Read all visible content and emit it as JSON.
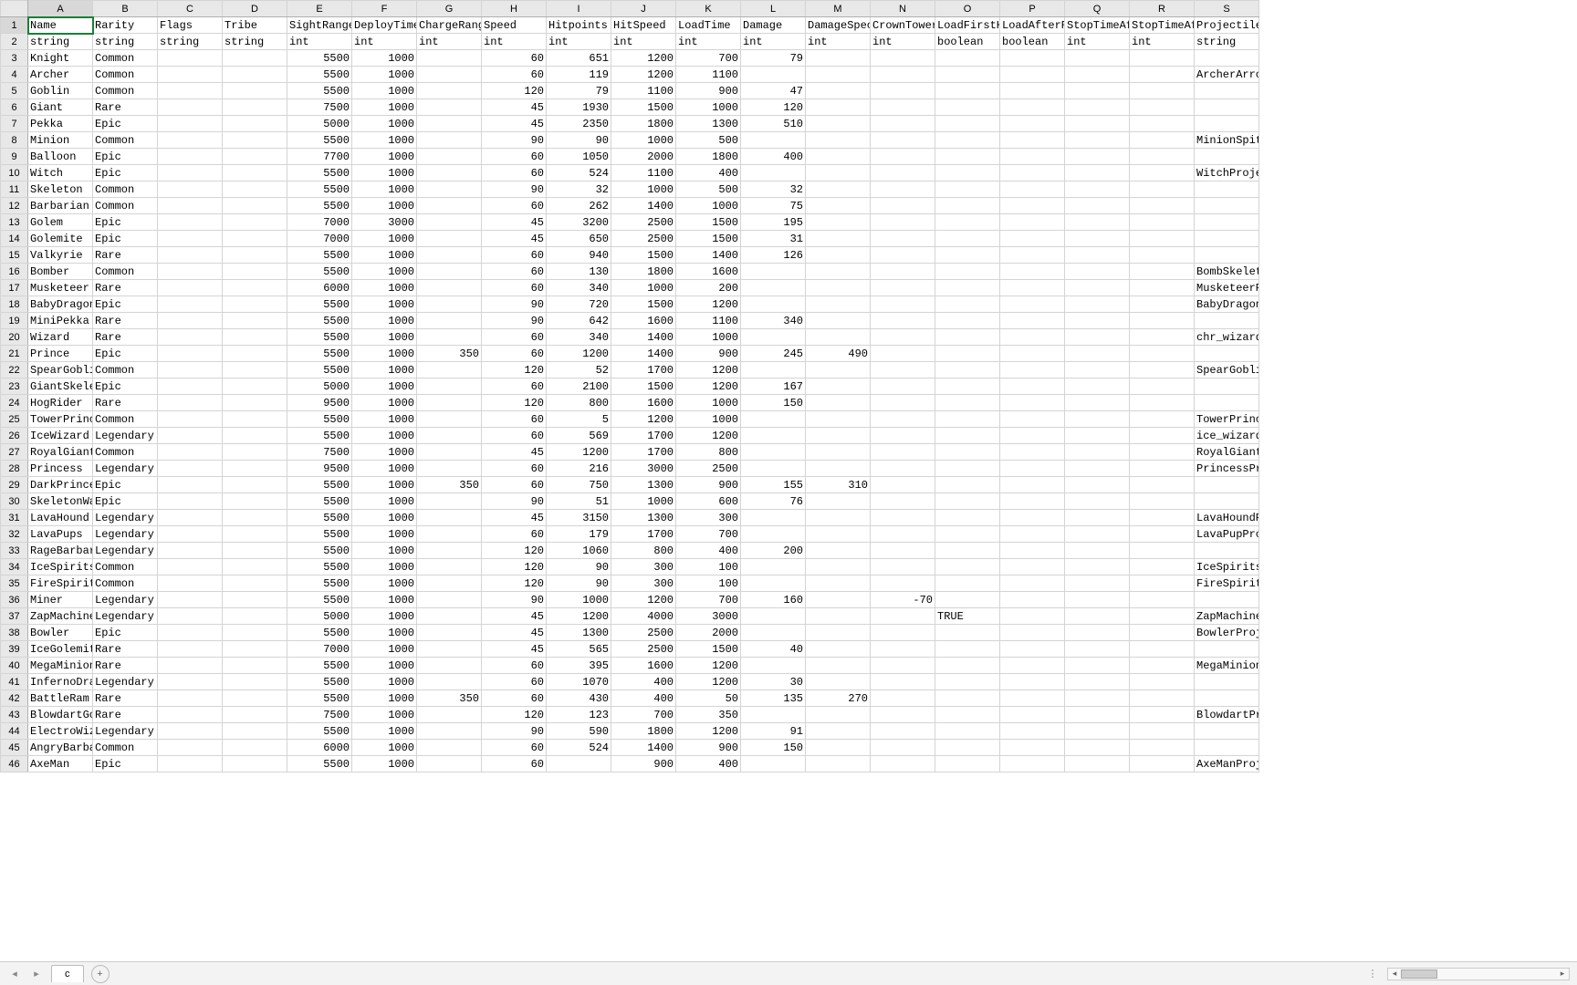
{
  "columns": [
    "A",
    "B",
    "C",
    "D",
    "E",
    "F",
    "G",
    "H",
    "I",
    "J",
    "K",
    "L",
    "M",
    "N",
    "O",
    "P",
    "Q",
    "R",
    "S"
  ],
  "rows": [
    {
      "n": 1,
      "cells": [
        "Name",
        "Rarity",
        "Flags",
        "Tribe",
        "SightRange",
        "DeployTime",
        "ChargeRange",
        "Speed",
        "Hitpoints",
        "HitSpeed",
        "LoadTime",
        "Damage",
        "DamageSpecial",
        "CrownTowerDamage",
        "LoadFirstHit",
        "LoadAfterRetarget",
        "StopTimeAfterAttack",
        "StopTimeAfterSpecialAttack",
        "Projectile"
      ]
    },
    {
      "n": 2,
      "cells": [
        "string",
        "string",
        "string",
        "string",
        "int",
        "int",
        "int",
        "int",
        "int",
        "int",
        "int",
        "int",
        "int",
        "int",
        "boolean",
        "boolean",
        "int",
        "int",
        "string"
      ]
    },
    {
      "n": 3,
      "cells": [
        "Knight",
        "Common",
        "",
        "",
        "5500",
        "1000",
        "",
        "60",
        "651",
        "1200",
        "700",
        "79",
        "",
        "",
        "",
        "",
        "",
        "",
        ""
      ]
    },
    {
      "n": 4,
      "cells": [
        "Archer",
        "Common",
        "",
        "",
        "5500",
        "1000",
        "",
        "60",
        "119",
        "1200",
        "1100",
        "",
        "",
        "",
        "",
        "",
        "",
        "",
        "ArcherArrow"
      ]
    },
    {
      "n": 5,
      "cells": [
        "Goblin",
        "Common",
        "",
        "",
        "5500",
        "1000",
        "",
        "120",
        "79",
        "1100",
        "900",
        "47",
        "",
        "",
        "",
        "",
        "",
        "",
        ""
      ]
    },
    {
      "n": 6,
      "cells": [
        "Giant",
        "Rare",
        "",
        "",
        "7500",
        "1000",
        "",
        "45",
        "1930",
        "1500",
        "1000",
        "120",
        "",
        "",
        "",
        "",
        "",
        "",
        ""
      ]
    },
    {
      "n": 7,
      "cells": [
        "Pekka",
        "Epic",
        "",
        "",
        "5000",
        "1000",
        "",
        "45",
        "2350",
        "1800",
        "1300",
        "510",
        "",
        "",
        "",
        "",
        "",
        "",
        ""
      ]
    },
    {
      "n": 8,
      "cells": [
        "Minion",
        "Common",
        "",
        "",
        "5500",
        "1000",
        "",
        "90",
        "90",
        "1000",
        "500",
        "",
        "",
        "",
        "",
        "",
        "",
        "",
        "MinionSpit"
      ]
    },
    {
      "n": 9,
      "cells": [
        "Balloon",
        "Epic",
        "",
        "",
        "7700",
        "1000",
        "",
        "60",
        "1050",
        "2000",
        "1800",
        "400",
        "",
        "",
        "",
        "",
        "",
        "",
        ""
      ]
    },
    {
      "n": 10,
      "cells": [
        "Witch",
        "Epic",
        "",
        "",
        "5500",
        "1000",
        "",
        "60",
        "524",
        "1100",
        "400",
        "",
        "",
        "",
        "",
        "",
        "",
        "",
        "WitchProjectile"
      ]
    },
    {
      "n": 11,
      "cells": [
        "Skeleton",
        "Common",
        "",
        "",
        "5500",
        "1000",
        "",
        "90",
        "32",
        "1000",
        "500",
        "32",
        "",
        "",
        "",
        "",
        "",
        "",
        ""
      ]
    },
    {
      "n": 12,
      "cells": [
        "Barbarian",
        "Common",
        "",
        "",
        "5500",
        "1000",
        "",
        "60",
        "262",
        "1400",
        "1000",
        "75",
        "",
        "",
        "",
        "",
        "",
        "",
        ""
      ]
    },
    {
      "n": 13,
      "cells": [
        "Golem",
        "Epic",
        "",
        "",
        "7000",
        "3000",
        "",
        "45",
        "3200",
        "2500",
        "1500",
        "195",
        "",
        "",
        "",
        "",
        "",
        "",
        ""
      ]
    },
    {
      "n": 14,
      "cells": [
        "Golemite",
        "Epic",
        "",
        "",
        "7000",
        "1000",
        "",
        "45",
        "650",
        "2500",
        "1500",
        "31",
        "",
        "",
        "",
        "",
        "",
        "",
        ""
      ]
    },
    {
      "n": 15,
      "cells": [
        "Valkyrie",
        "Rare",
        "",
        "",
        "5500",
        "1000",
        "",
        "60",
        "940",
        "1500",
        "1400",
        "126",
        "",
        "",
        "",
        "",
        "",
        "",
        ""
      ]
    },
    {
      "n": 16,
      "cells": [
        "Bomber",
        "Common",
        "",
        "",
        "5500",
        "1000",
        "",
        "60",
        "130",
        "1800",
        "1600",
        "",
        "",
        "",
        "",
        "",
        "",
        "",
        "BombSkeletonProjectile"
      ]
    },
    {
      "n": 17,
      "cells": [
        "Musketeer",
        "Rare",
        "",
        "",
        "6000",
        "1000",
        "",
        "60",
        "340",
        "1000",
        "200",
        "",
        "",
        "",
        "",
        "",
        "",
        "",
        "MusketeerProjectile"
      ]
    },
    {
      "n": 18,
      "cells": [
        "BabyDragon",
        "Epic",
        "",
        "",
        "5500",
        "1000",
        "",
        "90",
        "720",
        "1500",
        "1200",
        "",
        "",
        "",
        "",
        "",
        "",
        "",
        "BabyDragonProjectile"
      ]
    },
    {
      "n": 19,
      "cells": [
        "MiniPekka",
        "Rare",
        "",
        "",
        "5500",
        "1000",
        "",
        "90",
        "642",
        "1600",
        "1100",
        "340",
        "",
        "",
        "",
        "",
        "",
        "",
        ""
      ]
    },
    {
      "n": 20,
      "cells": [
        "Wizard",
        "Rare",
        "",
        "",
        "5500",
        "1000",
        "",
        "60",
        "340",
        "1400",
        "1000",
        "",
        "",
        "",
        "",
        "",
        "",
        "",
        "chr_wizardProjectile"
      ]
    },
    {
      "n": 21,
      "cells": [
        "Prince",
        "Epic",
        "",
        "",
        "5500",
        "1000",
        "350",
        "60",
        "1200",
        "1400",
        "900",
        "245",
        "490",
        "",
        "",
        "",
        "",
        "",
        ""
      ]
    },
    {
      "n": 22,
      "cells": [
        "SpearGoblin",
        "Common",
        "",
        "",
        "5500",
        "1000",
        "",
        "120",
        "52",
        "1700",
        "1200",
        "",
        "",
        "",
        "",
        "",
        "",
        "",
        "SpearGoblinProjectile"
      ]
    },
    {
      "n": 23,
      "cells": [
        "GiantSkeleton",
        "Epic",
        "",
        "",
        "5000",
        "1000",
        "",
        "60",
        "2100",
        "1500",
        "1200",
        "167",
        "",
        "",
        "",
        "",
        "",
        "",
        ""
      ]
    },
    {
      "n": 24,
      "cells": [
        "HogRider",
        "Rare",
        "",
        "",
        "9500",
        "1000",
        "",
        "120",
        "800",
        "1600",
        "1000",
        "150",
        "",
        "",
        "",
        "",
        "",
        "",
        ""
      ]
    },
    {
      "n": 25,
      "cells": [
        "TowerPrincess",
        "Common",
        "",
        "",
        "5500",
        "1000",
        "",
        "60",
        "5",
        "1200",
        "1000",
        "",
        "",
        "",
        "",
        "",
        "",
        "",
        "TowerPrincessProjectile"
      ]
    },
    {
      "n": 26,
      "cells": [
        "IceWizard",
        "Legendary",
        "",
        "",
        "5500",
        "1000",
        "",
        "60",
        "569",
        "1700",
        "1200",
        "",
        "",
        "",
        "",
        "",
        "",
        "",
        "ice_wizardProjectile"
      ]
    },
    {
      "n": 27,
      "cells": [
        "RoyalGiant",
        "Common",
        "",
        "",
        "7500",
        "1000",
        "",
        "45",
        "1200",
        "1700",
        "800",
        "",
        "",
        "",
        "",
        "",
        "",
        "",
        "RoyalGiantProjectile"
      ]
    },
    {
      "n": 28,
      "cells": [
        "Princess",
        "Legendary",
        "",
        "",
        "9500",
        "1000",
        "",
        "60",
        "216",
        "3000",
        "2500",
        "",
        "",
        "",
        "",
        "",
        "",
        "",
        "PrincessProjectile"
      ]
    },
    {
      "n": 29,
      "cells": [
        "DarkPrince",
        "Epic",
        "",
        "",
        "5500",
        "1000",
        "350",
        "60",
        "750",
        "1300",
        "900",
        "155",
        "310",
        "",
        "",
        "",
        "",
        "",
        ""
      ]
    },
    {
      "n": 30,
      "cells": [
        "SkeletonWarrior",
        "Epic",
        "",
        "",
        "5500",
        "1000",
        "",
        "90",
        "51",
        "1000",
        "600",
        "76",
        "",
        "",
        "",
        "",
        "",
        "",
        ""
      ]
    },
    {
      "n": 31,
      "cells": [
        "LavaHound",
        "Legendary",
        "",
        "",
        "5500",
        "1000",
        "",
        "45",
        "3150",
        "1300",
        "300",
        "",
        "",
        "",
        "",
        "",
        "",
        "",
        "LavaHoundProjectile"
      ]
    },
    {
      "n": 32,
      "cells": [
        "LavaPups",
        "Legendary",
        "",
        "",
        "5500",
        "1000",
        "",
        "60",
        "179",
        "1700",
        "700",
        "",
        "",
        "",
        "",
        "",
        "",
        "",
        "LavaPupProjectile"
      ]
    },
    {
      "n": 33,
      "cells": [
        "RageBarbarian",
        "Legendary",
        "",
        "",
        "5500",
        "1000",
        "",
        "120",
        "1060",
        "800",
        "400",
        "200",
        "",
        "",
        "",
        "",
        "",
        "",
        ""
      ]
    },
    {
      "n": 34,
      "cells": [
        "IceSpirits",
        "Common",
        "",
        "",
        "5500",
        "1000",
        "",
        "120",
        "90",
        "300",
        "100",
        "",
        "",
        "",
        "",
        "",
        "",
        "",
        "IceSpiritsProjectile"
      ]
    },
    {
      "n": 35,
      "cells": [
        "FireSpirits",
        "Common",
        "",
        "",
        "5500",
        "1000",
        "",
        "120",
        "90",
        "300",
        "100",
        "",
        "",
        "",
        "",
        "",
        "",
        "",
        "FireSpiritsProjectile"
      ]
    },
    {
      "n": 36,
      "cells": [
        "Miner",
        "Legendary",
        "",
        "",
        "5500",
        "1000",
        "",
        "90",
        "1000",
        "1200",
        "700",
        "160",
        "",
        "-70",
        "",
        "",
        "",
        "",
        ""
      ]
    },
    {
      "n": 37,
      "cells": [
        "ZapMachine",
        "Legendary",
        "",
        "",
        "5000",
        "1000",
        "",
        "45",
        "1200",
        "4000",
        "3000",
        "",
        "",
        "",
        "TRUE",
        "",
        "",
        "",
        "ZapMachineProjectile"
      ]
    },
    {
      "n": 38,
      "cells": [
        "Bowler",
        "Epic",
        "",
        "",
        "5500",
        "1000",
        "",
        "45",
        "1300",
        "2500",
        "2000",
        "",
        "",
        "",
        "",
        "",
        "",
        "",
        "BowlerProjectile"
      ]
    },
    {
      "n": 39,
      "cells": [
        "IceGolemite",
        "Rare",
        "",
        "",
        "7000",
        "1000",
        "",
        "45",
        "565",
        "2500",
        "1500",
        "40",
        "",
        "",
        "",
        "",
        "",
        "",
        ""
      ]
    },
    {
      "n": 40,
      "cells": [
        "MegaMinion",
        "Rare",
        "",
        "",
        "5500",
        "1000",
        "",
        "60",
        "395",
        "1600",
        "1200",
        "",
        "",
        "",
        "",
        "",
        "",
        "",
        "MegaMinionSpit"
      ]
    },
    {
      "n": 41,
      "cells": [
        "InfernoDragon",
        "Legendary",
        "",
        "",
        "5500",
        "1000",
        "",
        "60",
        "1070",
        "400",
        "1200",
        "30",
        "",
        "",
        "",
        "",
        "",
        "",
        ""
      ]
    },
    {
      "n": 42,
      "cells": [
        "BattleRam",
        "Rare",
        "",
        "",
        "5500",
        "1000",
        "350",
        "60",
        "430",
        "400",
        "50",
        "135",
        "270",
        "",
        "",
        "",
        "",
        "",
        ""
      ]
    },
    {
      "n": 43,
      "cells": [
        "BlowdartGoblin",
        "Rare",
        "",
        "",
        "7500",
        "1000",
        "",
        "120",
        "123",
        "700",
        "350",
        "",
        "",
        "",
        "",
        "",
        "",
        "",
        "BlowdartProjectile"
      ]
    },
    {
      "n": 44,
      "cells": [
        "ElectroWizard",
        "Legendary",
        "",
        "",
        "5500",
        "1000",
        "",
        "90",
        "590",
        "1800",
        "1200",
        "91",
        "",
        "",
        "",
        "",
        "",
        "",
        ""
      ]
    },
    {
      "n": 45,
      "cells": [
        "AngryBarbarian",
        "Common",
        "",
        "",
        "6000",
        "1000",
        "",
        "60",
        "524",
        "1400",
        "900",
        "150",
        "",
        "",
        "",
        "",
        "",
        "",
        ""
      ]
    },
    {
      "n": 46,
      "cells": [
        "AxeMan",
        "Epic",
        "",
        "",
        "5500",
        "1000",
        "",
        "60",
        "",
        "900",
        "400",
        "",
        "",
        "",
        "",
        "",
        "",
        "",
        "AxeManProjectile"
      ]
    }
  ],
  "numericCols": [
    4,
    5,
    6,
    7,
    8,
    9,
    10,
    11,
    12,
    13,
    16,
    17
  ],
  "selected": {
    "row": 1,
    "col": 0
  },
  "sheet": {
    "name": "c"
  },
  "icons": {
    "prev": "◂",
    "next": "▸",
    "plus": "+",
    "menu": "⋮"
  }
}
